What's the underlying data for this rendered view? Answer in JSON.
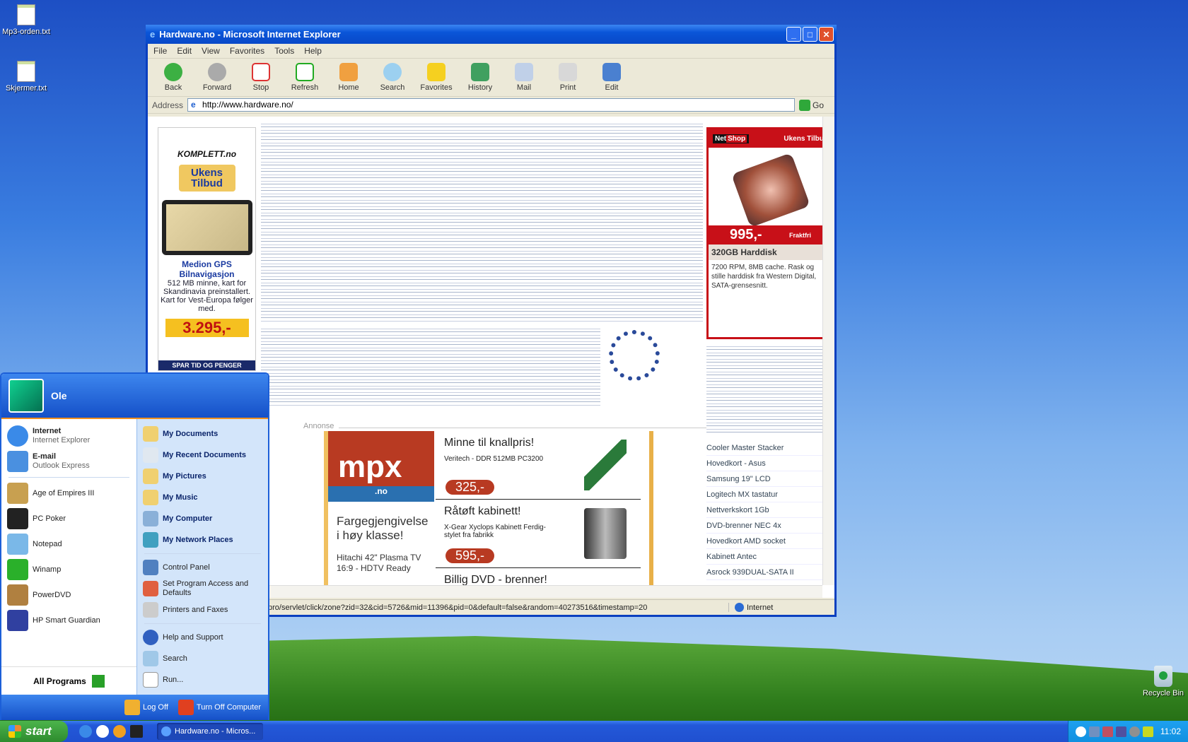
{
  "desktop": {
    "icons": [
      {
        "label": "Mp3-orden.txt"
      },
      {
        "label": "Skjermer.txt"
      }
    ],
    "recycle_bin": "Recycle Bin"
  },
  "ie": {
    "title": "Hardware.no - Microsoft Internet Explorer",
    "menu": [
      "File",
      "Edit",
      "View",
      "Favorites",
      "Tools",
      "Help"
    ],
    "toolbar": [
      "Back",
      "Forward",
      "Stop",
      "Refresh",
      "Home",
      "Search",
      "Favorites",
      "History",
      "Mail",
      "Print",
      "Edit"
    ],
    "address_label": "Address",
    "url": "http://www.hardware.no/",
    "go": "Go",
    "status_text": "pro/servlet/click/zone?zid=32&cid=5726&mid=11396&pid=0&default=false&random=40273516&timestamp=20",
    "zone": "Internet",
    "page": {
      "left_ad": {
        "brand": "KOMPLETT.no",
        "tag": "Ukens Tilbud",
        "product": "Medion GPS Bilnavigasjon",
        "desc": "512 MB minne, kart for Skandinavia preinstallert. Kart for Vest-Europa følger med.",
        "price": "3.295,-",
        "footer": "SPAR TID OG PENGER"
      },
      "right_ad": {
        "brand_a": "Net",
        "brand_b": "Shop",
        "header": "Ukens Tilbud",
        "price": "995,-",
        "price_note": "Fraktfri",
        "title": "320GB Harddisk",
        "desc": "7200 RPM, 8MB cache. Rask og stille harddisk fra Western Digital, SATA-grensesnitt."
      },
      "annonse": "Annonse",
      "mpx_ad": {
        "logo": "mpx",
        "logo_sub": ".no",
        "headline": "Fargegjengivelse i høy klasse!",
        "left_product": "Hitachi 42\" Plasma TV 16:9 - HDTV Ready",
        "products": [
          {
            "title": "Minne til knallpris!",
            "desc": "Veritech - DDR 512MB PC3200",
            "price": "325,-"
          },
          {
            "title": "Råtøft kabinett!",
            "desc": "X-Gear Xyclops Kabinett Ferdig-stylet fra fabrikk",
            "price": "595,-"
          },
          {
            "title": "Billig DVD - brenner!",
            "desc": "",
            "price": ""
          }
        ]
      },
      "right_list": [
        "Cooler Master Stacker",
        "Hovedkort - Asus",
        "Samsung 19\" LCD",
        "Logitech MX tastatur",
        "Nettverkskort 1Gb",
        "DVD-brenner NEC 4x",
        "Hovedkort AMD socket",
        "Kabinett Antec",
        "Asrock 939DUAL-SATA II"
      ]
    }
  },
  "start_menu": {
    "user": "Ole",
    "pinned": [
      {
        "title": "Internet",
        "sub": "Internet Explorer"
      },
      {
        "title": "E-mail",
        "sub": "Outlook Express"
      }
    ],
    "recent": [
      {
        "title": "Age of Empires III"
      },
      {
        "title": "PC Poker"
      },
      {
        "title": "Notepad"
      },
      {
        "title": "Winamp"
      },
      {
        "title": "PowerDVD"
      },
      {
        "title": "HP Smart Guardian"
      }
    ],
    "all_programs": "All Programs",
    "right": [
      {
        "label": "My Documents",
        "bold": true
      },
      {
        "label": "My Recent Documents",
        "bold": true
      },
      {
        "label": "My Pictures",
        "bold": true
      },
      {
        "label": "My Music",
        "bold": true
      },
      {
        "label": "My Computer",
        "bold": true
      },
      {
        "label": "My Network Places",
        "bold": true
      },
      {
        "label": "Control Panel"
      },
      {
        "label": "Set Program Access and Defaults"
      },
      {
        "label": "Printers and Faxes"
      },
      {
        "label": "Help and Support"
      },
      {
        "label": "Search"
      },
      {
        "label": "Run..."
      }
    ],
    "log_off": "Log Off",
    "turn_off": "Turn Off Computer"
  },
  "taskbar": {
    "start": "start",
    "task": "Hardware.no - Micros...",
    "clock": "11:02"
  }
}
